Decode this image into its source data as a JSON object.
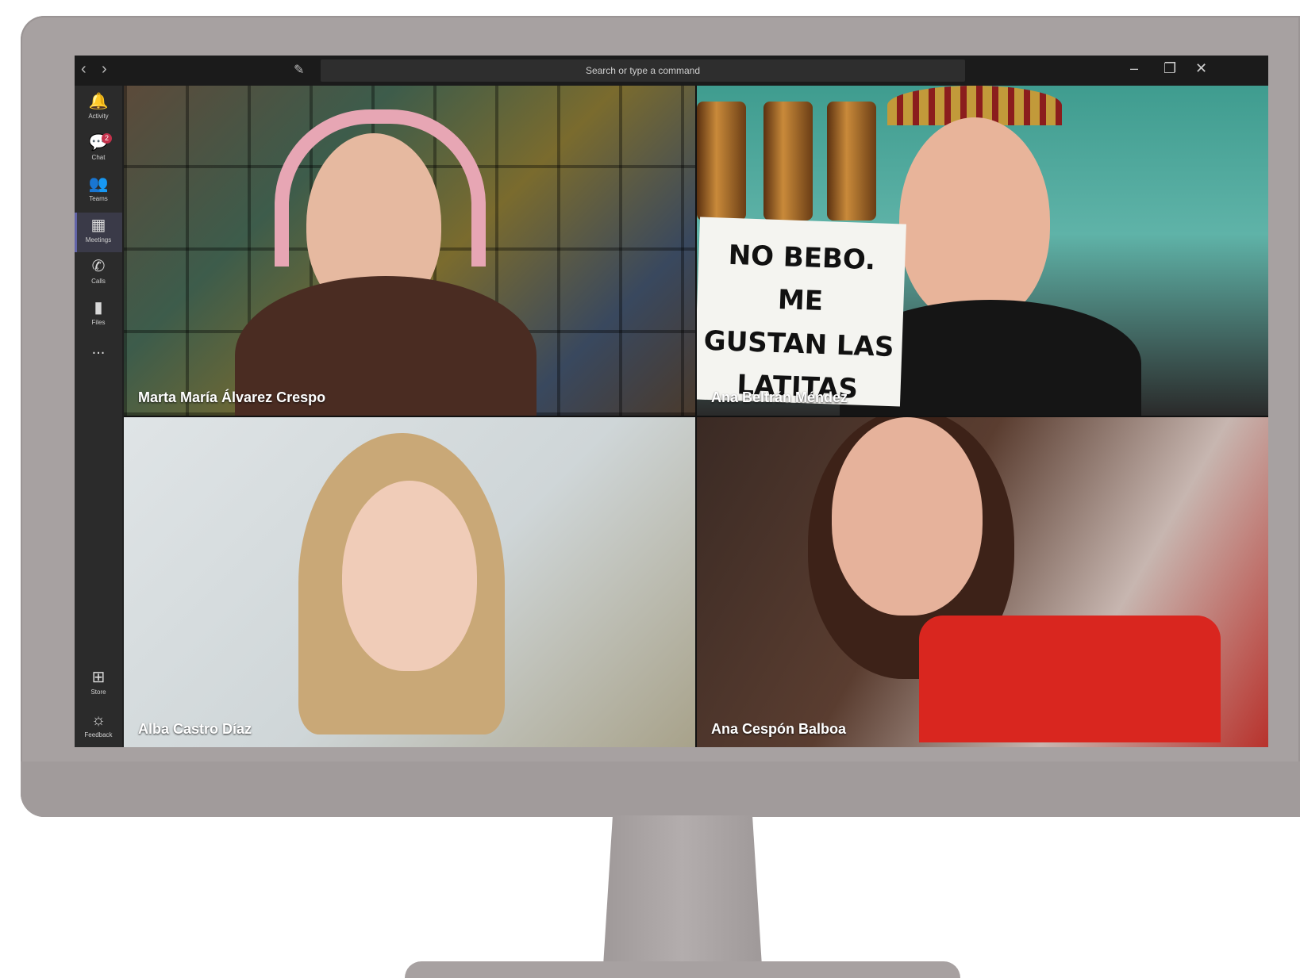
{
  "titlebar": {
    "back_icon": "chevron-left-icon",
    "forward_icon": "chevron-right-icon",
    "compose_icon": "new-chat-icon",
    "search_placeholder": "Search or type a command",
    "minimize": "–",
    "restore": "❐",
    "close": "✕"
  },
  "rail": {
    "items": [
      {
        "label": "Activity",
        "icon": "bell-icon"
      },
      {
        "label": "Chat",
        "icon": "chat-icon",
        "badge": "2"
      },
      {
        "label": "Teams",
        "icon": "teams-icon"
      },
      {
        "label": "Meetings",
        "icon": "calendar-icon",
        "active": true
      },
      {
        "label": "Calls",
        "icon": "phone-icon"
      },
      {
        "label": "Files",
        "icon": "file-icon"
      },
      {
        "label": "...",
        "icon": "more-icon"
      }
    ],
    "bottom_items": [
      {
        "label": "Store",
        "icon": "store-icon"
      },
      {
        "label": "Feedback",
        "icon": "feedback-icon"
      }
    ]
  },
  "participants": [
    {
      "name": "Marta María Álvarez Crespo"
    },
    {
      "name": "Ana Beltrán Méndez",
      "sign_text": [
        "NO BEBO. ME",
        "GUSTAN LAS",
        "LATITAS"
      ]
    },
    {
      "name": "Alba Castro Díaz"
    },
    {
      "name": "Ana Cespón Balboa"
    }
  ],
  "colors": {
    "app_bg": "#1f1f1f",
    "rail_bg": "#2b2b2b",
    "accent": "#6264a7",
    "badge": "#c4314b",
    "monitor": "#a7a1a1"
  }
}
